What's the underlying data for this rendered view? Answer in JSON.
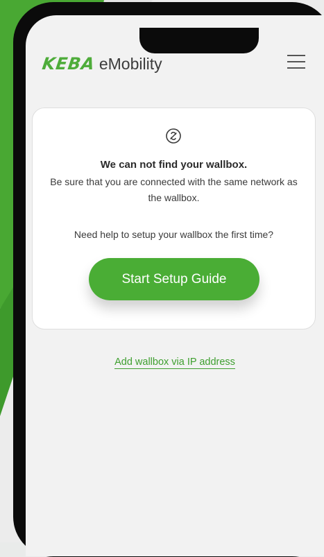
{
  "header": {
    "logo_mark": "KEBA",
    "logo_text": "eMobility"
  },
  "card": {
    "title": "We can not find your wallbox.",
    "description": "Be sure that you are connected with the same network as the wallbox.",
    "help_text": "Need help to setup your wallbox the first time?",
    "button_label": "Start Setup Guide"
  },
  "footer": {
    "link_label": "Add wallbox via IP address"
  },
  "colors": {
    "brand_green": "#4aad35",
    "text": "#3a3a3a",
    "background": "#f2f2f2"
  },
  "icons": {
    "menu": "hamburger-menu-icon",
    "warning": "no-connection-icon"
  }
}
